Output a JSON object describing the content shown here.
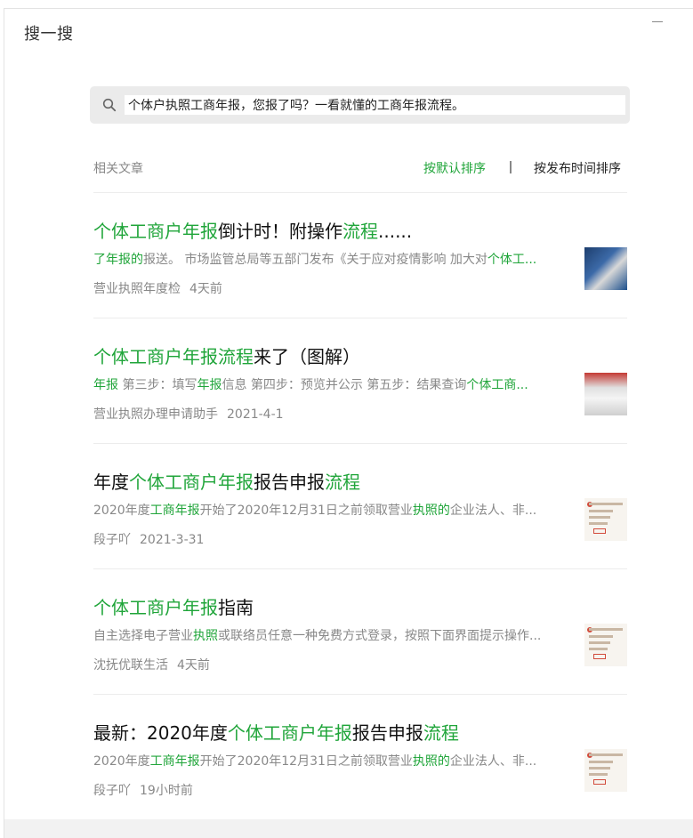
{
  "window": {
    "title": "搜一搜"
  },
  "search": {
    "query": "个体户执照工商年报，您报了吗？一看就懂的工商年报流程。"
  },
  "list_header": {
    "label": "相关文章",
    "sort_default": "按默认排序",
    "sort_time": "按发布时间排序"
  },
  "colors": {
    "highlight": "#20a53a",
    "text": "#111111",
    "muted": "#888888"
  },
  "results": [
    {
      "title": [
        {
          "t": "个体工商户年报",
          "hl": true
        },
        {
          "t": "倒计时！附操作",
          "hl": false
        },
        {
          "t": "流程",
          "hl": true
        },
        {
          "t": "......",
          "hl": false
        }
      ],
      "snippet": [
        {
          "t": "了年报的",
          "hl": true
        },
        {
          "t": "报送。 市场监管总局等五部门发布《关于应对疫情影响 加大对",
          "hl": false
        },
        {
          "t": "个体工...",
          "hl": true
        }
      ],
      "source": "营业执照年度检",
      "time": "4天前"
    },
    {
      "title": [
        {
          "t": "个体工商户年报流程",
          "hl": true
        },
        {
          "t": "来了（图解）",
          "hl": false
        }
      ],
      "snippet": [
        {
          "t": "年报",
          "hl": true
        },
        {
          "t": " 第三步：填写",
          "hl": false
        },
        {
          "t": "年报",
          "hl": true
        },
        {
          "t": "信息 第四步：预览并公示 第五步：结果查询",
          "hl": false
        },
        {
          "t": "个体工商...",
          "hl": true
        }
      ],
      "source": "营业执照办理申请助手",
      "time": "2021-4-1"
    },
    {
      "title": [
        {
          "t": "年度",
          "hl": false
        },
        {
          "t": "个体工商户年报",
          "hl": true
        },
        {
          "t": "报告申报",
          "hl": false
        },
        {
          "t": "流程",
          "hl": true
        }
      ],
      "snippet": [
        {
          "t": "2020年度",
          "hl": false
        },
        {
          "t": "工商年报",
          "hl": true
        },
        {
          "t": "开始了2020年12月31日之前领取营业",
          "hl": false
        },
        {
          "t": "执照的",
          "hl": true
        },
        {
          "t": "企业法人、非...",
          "hl": false
        }
      ],
      "source": "段子吖",
      "time": "2021-3-31"
    },
    {
      "title": [
        {
          "t": "个体工商户年报",
          "hl": true
        },
        {
          "t": "指南",
          "hl": false
        }
      ],
      "snippet": [
        {
          "t": "自主选择电子营业",
          "hl": false
        },
        {
          "t": "执照",
          "hl": true
        },
        {
          "t": "或联络员任意一种免费方式登录，按照下面界面提示操作...",
          "hl": false
        }
      ],
      "source": "沈抚优联生活",
      "time": "4天前"
    },
    {
      "title": [
        {
          "t": "最新：2020年度",
          "hl": false
        },
        {
          "t": "个体工商户年报",
          "hl": true
        },
        {
          "t": "报告申报",
          "hl": false
        },
        {
          "t": "流程",
          "hl": true
        }
      ],
      "snippet": [
        {
          "t": "2020年度",
          "hl": false
        },
        {
          "t": "工商年报",
          "hl": true
        },
        {
          "t": "开始了2020年12月31日之前领取营业",
          "hl": false
        },
        {
          "t": "执照的",
          "hl": true
        },
        {
          "t": "企业法人、非...",
          "hl": false
        }
      ],
      "source": "段子吖",
      "time": "19小时前"
    }
  ]
}
